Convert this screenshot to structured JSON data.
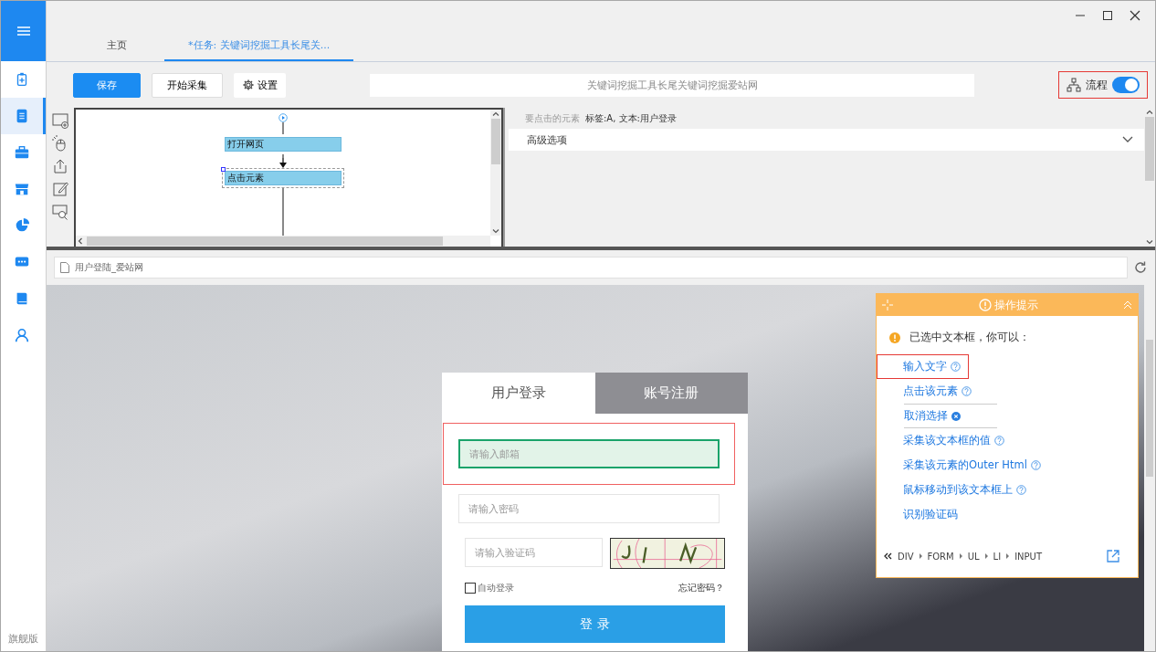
{
  "sidebar": {
    "items": [
      {
        "selected": false
      },
      {
        "selected": true
      },
      {
        "selected": false
      },
      {
        "selected": false
      },
      {
        "selected": false
      },
      {
        "selected": false
      },
      {
        "selected": false
      },
      {
        "selected": false
      }
    ],
    "edition": "旗舰版"
  },
  "tabs": [
    {
      "label": "主页",
      "selected": false
    },
    {
      "label": "*任务: 关键词挖掘工具长尾关...",
      "selected": true
    }
  ],
  "toolbar": {
    "save": "保存",
    "start": "开始采集",
    "settings": "设置",
    "task_name": "关键词挖掘工具长尾关键词挖掘爱站网",
    "flow_toggle": {
      "label": "流程",
      "on": true,
      "highlighted": true
    }
  },
  "flow": {
    "nodes": [
      {
        "label": "打开网页",
        "selected": false
      },
      {
        "label": "点击元素",
        "selected": true
      }
    ]
  },
  "properties": {
    "label": "要点击的元素",
    "value": "标签:A, 文本:用户登录",
    "advanced": {
      "label": "高级选项",
      "expanded": false
    }
  },
  "browser": {
    "address": "用户登陆_爱站网"
  },
  "login": {
    "tabs": [
      {
        "label": "用户登录",
        "selected": true
      },
      {
        "label": "账号注册",
        "selected": false
      }
    ],
    "fields": [
      {
        "placeholder": "请输入邮箱",
        "selected": true
      },
      {
        "placeholder": "请输入密码",
        "selected": false
      },
      {
        "placeholder": "请输入验证码",
        "selected": false
      }
    ],
    "remember": {
      "label": "自动登录",
      "checked": false
    },
    "forgot": "忘记密码？",
    "submit": "登 录"
  },
  "tip_panel": {
    "title": "操作提示",
    "message": "已选中文本框，你可以：",
    "actions": [
      {
        "label": "输入文字",
        "kind": "help",
        "selected": true
      },
      {
        "label": "点击该元素",
        "kind": "help",
        "selected": false
      },
      {
        "label": "取消选择",
        "kind": "cancel",
        "selected": false
      },
      {
        "label": "采集该文本框的值",
        "kind": "help",
        "selected": false
      },
      {
        "label": "采集该元素的Outer Html",
        "kind": "help",
        "selected": false
      },
      {
        "label": "鼠标移动到该文本框上",
        "kind": "help",
        "selected": false
      },
      {
        "label": "识别验证码",
        "kind": "plain",
        "selected": false
      }
    ],
    "breadcrumb": [
      "DIV",
      "FORM",
      "UL",
      "LI",
      "INPUT"
    ]
  }
}
